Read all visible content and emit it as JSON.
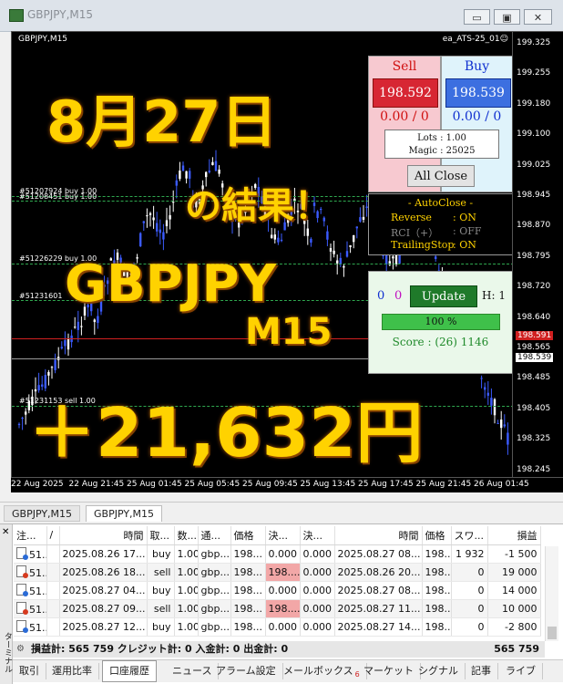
{
  "window": {
    "title": "GBPJPY,M15",
    "btn_min": "▭",
    "btn_max": "▣",
    "btn_close": "✕"
  },
  "chart": {
    "symbol_label": "GBPJPY,M15",
    "ea_label": "ea_ATS-25_01☺",
    "price_ticks": [
      "199.325",
      "199.255",
      "199.180",
      "199.100",
      "199.025",
      "198.945",
      "198.870",
      "198.795",
      "198.720",
      "198.640",
      "198.565",
      "198.485",
      "198.405",
      "198.325",
      "198.245"
    ],
    "price_tag_red": "198.591",
    "price_tag_current": "198.539",
    "time_ticks": [
      "22 Aug 2025",
      "22 Aug 21:45",
      "25 Aug 01:45",
      "25 Aug 05:45",
      "25 Aug 09:45",
      "25 Aug 13:45",
      "25 Aug 17:45",
      "25 Aug 21:45",
      "26 Aug 01:45"
    ],
    "order_labels": [
      "#51207924 buy 1.00",
      "#51208451 buy 1.00",
      "#51226229 buy 1.00",
      "#51231601",
      "#51231153 sell 1.00"
    ]
  },
  "overlay": {
    "date": "8月27日",
    "result": "の結果！",
    "pair": "GBPJPY",
    "timeframe": "M15",
    "profit": "＋21,632円"
  },
  "ea_panel": {
    "sell_label": "Sell",
    "sell_price": "198.592",
    "sell_pl": "0.00 / 0",
    "buy_label": "Buy",
    "buy_price": "198.539",
    "buy_pl": "0.00 / 0",
    "lots": "Lots   : 1.00",
    "magic": "Magic : 25025",
    "all_close": "All Close",
    "autoclose_title": "- AutoClose -",
    "reverse_label": "Reverse",
    "reverse_val": ": ON",
    "rci_label": "RCI（+）",
    "rci_val": ": OFF",
    "trailing_label": "TrailingStop",
    "trailing_val": ": ON",
    "count_a": "0",
    "count_b": "0",
    "update": "Update",
    "h_label": "H: 1",
    "progress_text": "100 %",
    "progress_fraction": 1.0,
    "score": "Score : (26) 1146"
  },
  "chart_tabs": [
    "GBPJPY,M15",
    "GBPJPY,M15"
  ],
  "terminal": {
    "side_label": "ターミナル",
    "columns": [
      "注...",
      "/",
      "時間",
      "取...",
      "数...",
      "通...",
      "価格",
      "決...",
      "決...",
      "時間",
      "価格",
      "スワ...",
      "損益"
    ],
    "rows": [
      {
        "id": "51...",
        "time": "2025.08.26 17...",
        "type": "buy",
        "vol": "1.00",
        "sym": "gbp...",
        "price": "198...",
        "sl": "0.000",
        "tp": "0.000",
        "ctime": "2025.08.27 08...",
        "cprice": "198...",
        "swap": "1 932",
        "profit": "-1 500",
        "hl": false,
        "icon": "blue"
      },
      {
        "id": "51...",
        "time": "2025.08.26 18...",
        "type": "sell",
        "vol": "1.00",
        "sym": "gbp...",
        "price": "198...",
        "sl": "198....",
        "tp": "0.000",
        "ctime": "2025.08.26 20...",
        "cprice": "198...",
        "swap": "0",
        "profit": "19 000",
        "hl": true,
        "icon": "red"
      },
      {
        "id": "51...",
        "time": "2025.08.27 04...",
        "type": "buy",
        "vol": "1.00",
        "sym": "gbp...",
        "price": "198...",
        "sl": "0.000",
        "tp": "0.000",
        "ctime": "2025.08.27 08...",
        "cprice": "198...",
        "swap": "0",
        "profit": "14 000",
        "hl": false,
        "icon": "blue"
      },
      {
        "id": "51...",
        "time": "2025.08.27 09...",
        "type": "sell",
        "vol": "1.00",
        "sym": "gbp...",
        "price": "198...",
        "sl": "198....",
        "tp": "0.000",
        "ctime": "2025.08.27 11...",
        "cprice": "198...",
        "swap": "0",
        "profit": "10 000",
        "hl": true,
        "icon": "red"
      },
      {
        "id": "51...",
        "time": "2025.08.27 12...",
        "type": "buy",
        "vol": "1.00",
        "sym": "gbp...",
        "price": "198...",
        "sl": "0.000",
        "tp": "0.000",
        "ctime": "2025.08.27 14...",
        "cprice": "198...",
        "swap": "0",
        "profit": "-2 800",
        "hl": false,
        "icon": "blue"
      }
    ],
    "totals": "損益計: 565 759  クレジット計: 0  入金計: 0  出金計: 0",
    "totals_right": "565 759",
    "tabs": [
      "取引",
      "運用比率",
      "口座履歴",
      "ニュース",
      "アラーム設定",
      "メールボックス",
      "マーケット",
      "シグナル",
      "記事",
      "ライブ"
    ],
    "mail_badge": "6"
  }
}
